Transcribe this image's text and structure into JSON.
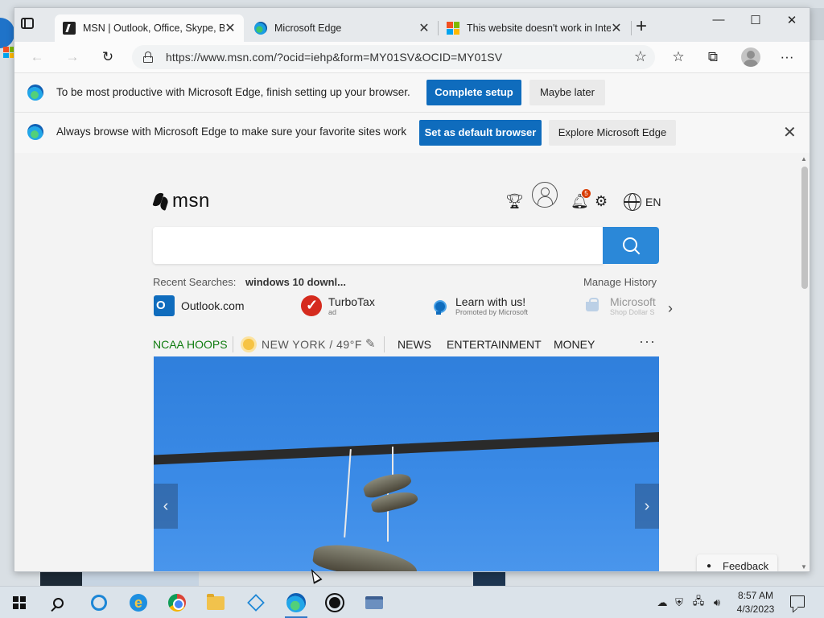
{
  "tabs": [
    {
      "title": "MSN | Outlook, Office, Skype, Bing",
      "favicon": "msn-icon",
      "active": true
    },
    {
      "title": "Microsoft Edge",
      "favicon": "edge-icon",
      "active": false
    },
    {
      "title": "This website doesn't work in Internet Explorer",
      "favicon": "microsoft-logo-icon",
      "active": false
    }
  ],
  "toolbar": {
    "url": "https://www.msn.com/?ocid=iehp&form=MY01SV&OCID=MY01SV"
  },
  "infobar1": {
    "message": "To be most productive with Microsoft Edge, finish setting up your browser.",
    "primary_label": "Complete setup",
    "secondary_label": "Maybe later"
  },
  "infobar2": {
    "message": "Always browse with Microsoft Edge to make sure your favorite sites work",
    "primary_label": "Set as default browser",
    "secondary_label": "Explore Microsoft Edge"
  },
  "msn": {
    "logo_text": "msn",
    "notification_count": "5",
    "language": "EN",
    "recent_label": "Recent Searches:",
    "recent_item": "windows 10 downl...",
    "manage_history": "Manage History",
    "quick_links": [
      {
        "name": "Outlook.com",
        "sub": ""
      },
      {
        "name": "TurboTax",
        "sub": "ad"
      },
      {
        "name": "Learn with us!",
        "sub": "Promoted by Microsoft"
      },
      {
        "name": "Microsoft",
        "sub": "Shop Dollar S"
      }
    ],
    "nav": {
      "ncaa": "NCAA HOOPS",
      "weather": "NEW YORK / 49°F",
      "news": "NEWS",
      "entertainment": "ENTERTAINMENT",
      "money": "MONEY",
      "more": "···"
    },
    "feedback": "Feedback"
  },
  "taskbar": {
    "time": "8:57 AM",
    "date": "4/3/2023"
  },
  "colors": {
    "accent": "#0f6cbd",
    "search_button": "#2b88d8",
    "ncaa": "#107c10"
  }
}
